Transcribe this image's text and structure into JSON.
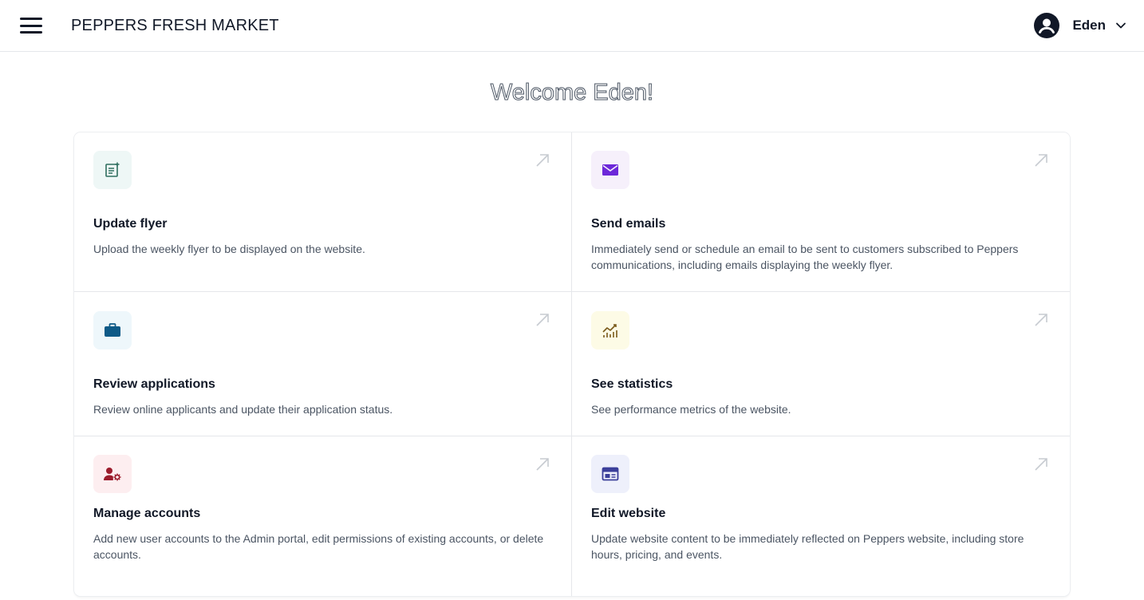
{
  "header": {
    "brand": "PEPPERS FRESH MARKET",
    "user_name": "Eden"
  },
  "welcome": "Welcome Eden!",
  "cards": [
    {
      "title": "Update flyer",
      "description": "Upload the weekly flyer to be displayed on the website.",
      "icon": "document-add-icon",
      "icon_bg": "#eef7f6",
      "icon_color": "#2f6f5f"
    },
    {
      "title": "Send emails",
      "description": "Immediately send or schedule an email to be sent to customers subscribed to Peppers communications, including emails displaying the weekly flyer.",
      "icon": "envelope-icon",
      "icon_bg": "#f6f0fb",
      "icon_color": "#6d28d9"
    },
    {
      "title": "Review applications",
      "description": "Review online applicants and update their application status.",
      "icon": "briefcase-icon",
      "icon_bg": "#eef7fb",
      "icon_color": "#0e5a87"
    },
    {
      "title": "See statistics",
      "description": "See performance metrics of the website.",
      "icon": "chart-icon",
      "icon_bg": "#fdfbe6",
      "icon_color": "#7a5a1a"
    },
    {
      "title": "Manage accounts",
      "description": "Add new user accounts to the Admin portal, edit permissions of existing accounts, or delete accounts.",
      "icon": "user-settings-icon",
      "icon_bg": "#fdeef0",
      "icon_color": "#9b1c2c"
    },
    {
      "title": "Edit website",
      "description": "Update website content to be immediately reflected on Peppers website, including store hours, pricing, and events.",
      "icon": "browser-window-icon",
      "icon_bg": "#eef0fb",
      "icon_color": "#3b3f9a"
    }
  ]
}
